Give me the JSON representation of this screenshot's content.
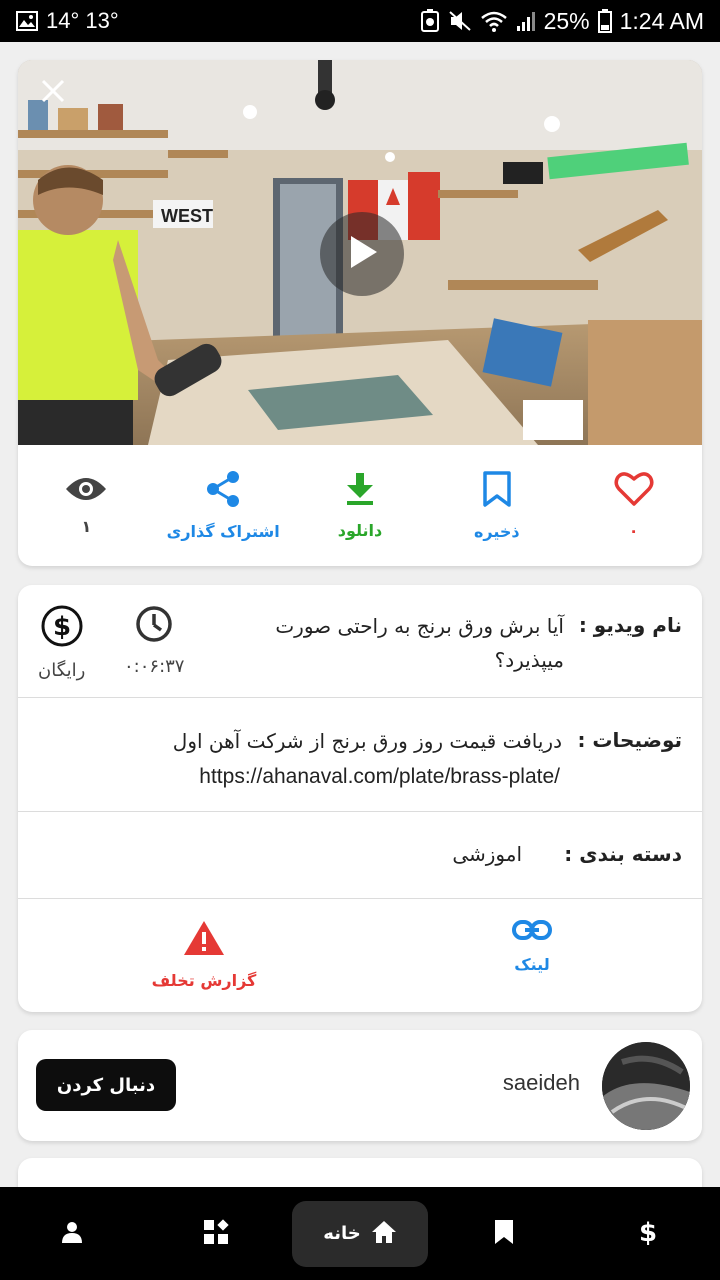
{
  "status_bar": {
    "temps": "14° 13°",
    "battery": "25%",
    "time": "1:24 AM"
  },
  "video": {
    "play_icon": "play-icon",
    "close_icon": "close-icon"
  },
  "actions": [
    {
      "id": "like",
      "label": "٠",
      "icon": "heart-icon",
      "color": "#e53935"
    },
    {
      "id": "save",
      "label": "ذخیره",
      "icon": "bookmark-icon",
      "color": "#1e88e5"
    },
    {
      "id": "download",
      "label": "دانلود",
      "icon": "download-icon",
      "color": "#2aa62a"
    },
    {
      "id": "share",
      "label": "اشتراک گذاری",
      "icon": "share-icon",
      "color": "#1e88e5"
    },
    {
      "id": "views",
      "label": "١",
      "icon": "eye-icon",
      "color": "#444444"
    }
  ],
  "info": {
    "name_label": "نام ویدیو :",
    "name_value": "آیا برش ورق برنج به راحتی صورت میپذیرد؟",
    "duration": "٠:٠۶:٣٧",
    "price": "رایگان",
    "desc_label": "توضیحات :",
    "desc_line1": "دریافت قیمت روز ورق برنج از شرکت آهن اول",
    "desc_line2": "https://ahanaval.com/plate/brass-plate/",
    "category_label": "دسته بندی :",
    "category_value": "اموزشی",
    "link_label": "لینک",
    "report_label": "گزارش تخلف"
  },
  "author": {
    "username": "saeideh",
    "follow_label": "دنبال کردن"
  },
  "bottom_nav": {
    "home_label": "خانه"
  },
  "colors": {
    "accent_blue": "#1e88e5",
    "accent_green": "#2aa62a",
    "accent_red": "#e53935"
  }
}
